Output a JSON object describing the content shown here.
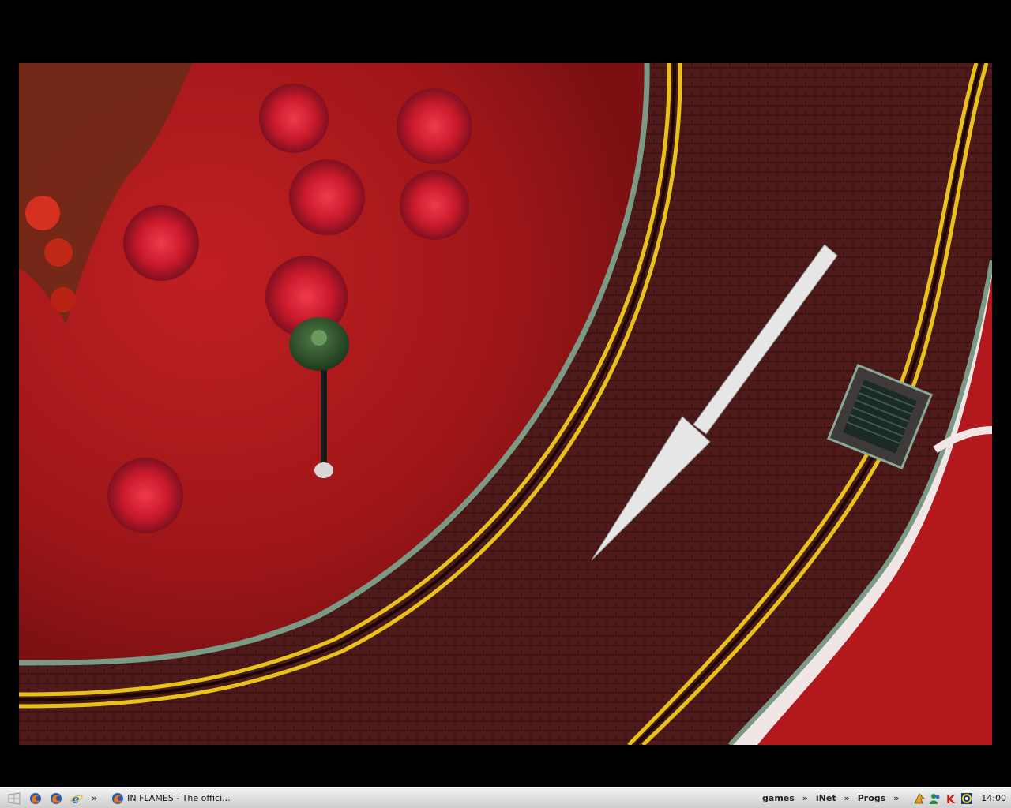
{
  "desktop": {
    "wallpaper_description_colors": {
      "grass": "#b3191c",
      "road": "#4a1f1f",
      "lines": "#e8c21c",
      "arrow": "#e6e6e6",
      "lamp": "#2e4a2a"
    }
  },
  "taskbar": {
    "quick_launch": [
      {
        "icon": "firefox-icon"
      },
      {
        "icon": "firefox-icon"
      },
      {
        "icon": "internet-explorer-icon"
      }
    ],
    "more_chevron": "»",
    "task": {
      "label": "IN FLAMES - The offici...",
      "icon": "firefox-icon"
    },
    "toolbars": [
      {
        "label": "games"
      },
      {
        "label": "iNet"
      },
      {
        "label": "Progs"
      }
    ],
    "chevron": "»",
    "tray_icons": [
      "winamp-icon",
      "messenger-icon",
      "kaspersky-icon",
      "network-icon"
    ],
    "clock": "14:00"
  }
}
